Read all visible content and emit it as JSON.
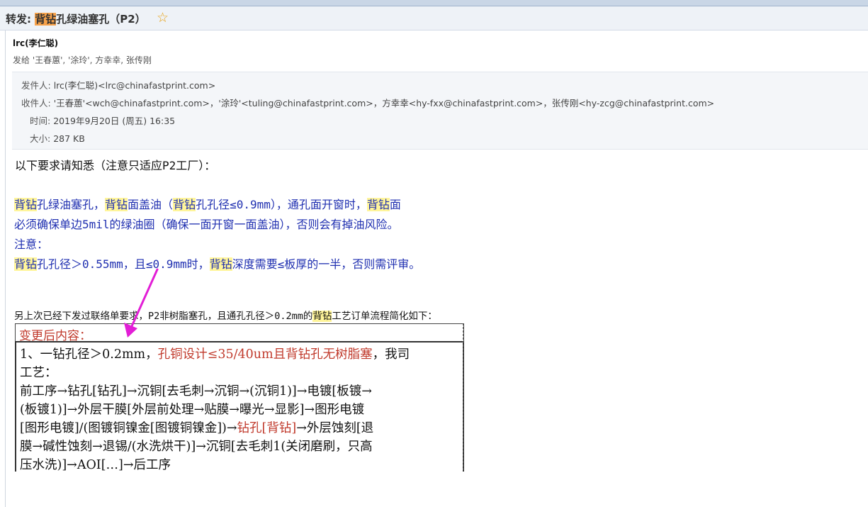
{
  "subject": {
    "prefix": "转发: ",
    "highlight": "背钻",
    "rest": "孔绿油塞孔（P2）"
  },
  "star_icon": "star",
  "sender": "lrc(李仁聪)",
  "send_to": "发给 '王春蕙', '涂玲', 方幸幸, 张传刚",
  "meta": {
    "from_label": "发件人:",
    "from_value": "lrc(李仁聪)<lrc@chinafastprint.com>",
    "to_label": "收件人:",
    "to_value": "'王春蕙'<wch@chinafastprint.com>，'涂玲'<tuling@chinafastprint.com>，方幸幸<hy-fxx@chinafastprint.com>，张传刚<hy-zcg@chinafastprint.com>",
    "time_label": "时间:",
    "time_value": "2019年9月20日 (周五) 16:35",
    "size_label": "大小:",
    "size_value": "287 KB"
  },
  "body": {
    "intro": "以下要求请知悉（注意只适应P2工厂）：",
    "kw": "背钻",
    "l1_a": "孔绿油塞孔，",
    "l1_b": "面盖油（",
    "l1_c": "孔孔径≤0.9mm），通孔面开窗时，",
    "l1_d": "面",
    "l2": "必须确保单边5mil的绿油圈（确保一面开窗一面盖油），否则会有掉油风险。",
    "note": "注意：",
    "l4_a": "孔孔径＞0.55mm，且≤0.9mm时，",
    "l4_b": "深度需要≤板厚的一半，否则需评审。",
    "l5_a": "另上次已经下发过联络单要求，P2非树脂塞孔，且通孔孔径＞0.2mm的",
    "l5_b": "工艺订单流程简化如下："
  },
  "box": {
    "header": "变更后内容：",
    "r1_a": "1、一钻孔径＞0.2mm，",
    "r1_b": "孔铜设计≤35/40um且背钻孔无树脂塞",
    "r1_c": "，我司",
    "r2": "工艺：",
    "r3": "前工序→钻孔[钻孔]→沉铜[去毛刺→沉铜→(沉铜1)]→电镀[板镀→",
    "r4": "(板镀1)]→外层干膜[外层前处理→贴膜→曝光→显影]→图形电镀",
    "r5_a": "[图形电镀]/(图镀铜镍金[图镀铜镍金])→",
    "r5_b": "钻孔[背钻]",
    "r5_c": "→外层蚀刻[退",
    "r6": "膜→碱性蚀刻→退锡/(水洗烘干)]→沉铜[去毛刺1(关闭磨刷，只高",
    "r7": "压水洗)]→AOI[…]→后工序"
  }
}
